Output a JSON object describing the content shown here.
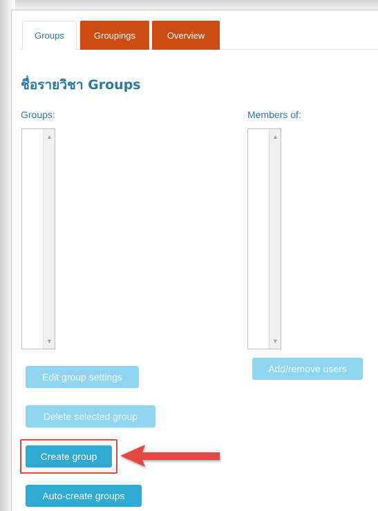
{
  "tabs": [
    {
      "label": "Groups",
      "active": true
    },
    {
      "label": "Groupings",
      "active": false
    },
    {
      "label": "Overview",
      "active": false
    }
  ],
  "page_title": "ชื่อรายวิชา Groups",
  "groups_column": {
    "label": "Groups:"
  },
  "members_column": {
    "label": "Members of:"
  },
  "buttons": {
    "edit_group_settings": "Edit group settings",
    "delete_selected_group": "Delete selected group",
    "create_group": "Create group",
    "auto_create_groups": "Auto-create groups",
    "add_remove_users": "Add/remove users"
  },
  "colors": {
    "accent": "#2a7aa0",
    "tab_orange": "#cc4c12",
    "button_primary": "#2eaad3",
    "button_disabled": "#8fd5ef",
    "annotation_red": "#e2473f"
  },
  "icons": {
    "scroll_up": "▲",
    "scroll_down": "▼"
  }
}
